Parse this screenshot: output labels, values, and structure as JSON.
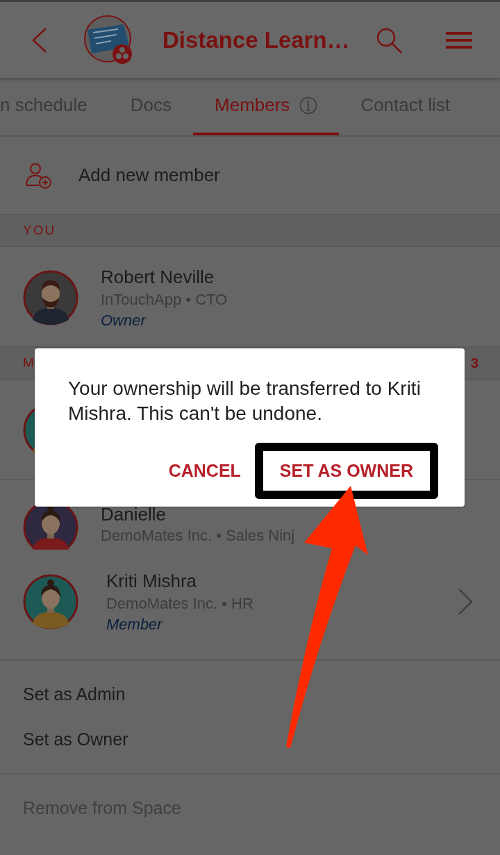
{
  "header": {
    "title": "Distance Learn…"
  },
  "tabs": [
    {
      "label": "n schedule",
      "selected": false,
      "info": false
    },
    {
      "label": "Docs",
      "selected": false,
      "info": false
    },
    {
      "label": "Members",
      "selected": true,
      "info": true
    },
    {
      "label": "Contact list",
      "selected": false,
      "info": false
    }
  ],
  "add_member": {
    "label": "Add new member"
  },
  "you_section": {
    "heading": "YOU",
    "member": {
      "name": "Robert Neville",
      "subtitle": "InTouchApp • CTO",
      "role": "Owner"
    }
  },
  "members_section": {
    "heading": "M",
    "count": "3",
    "member": {
      "name": "Danielle",
      "subtitle": "DemoMates Inc. • Sales Ninj"
    }
  },
  "sheet": {
    "member": {
      "name": "Kriti Mishra",
      "subtitle": "DemoMates Inc. • HR",
      "role": "Member"
    },
    "action_groups": [
      [
        {
          "label": "Set as Admin",
          "disabled": false
        },
        {
          "label": "Set as Owner",
          "disabled": false
        }
      ],
      [
        {
          "label": "Remove from Space",
          "disabled": true
        }
      ]
    ]
  },
  "dialog": {
    "message": "Your ownership will be transferred to Kriti Mishra. This can't be undone.",
    "buttons": [
      {
        "label": "CANCEL",
        "highlighted": false
      },
      {
        "label": "SET AS OWNER",
        "highlighted": true
      }
    ]
  }
}
